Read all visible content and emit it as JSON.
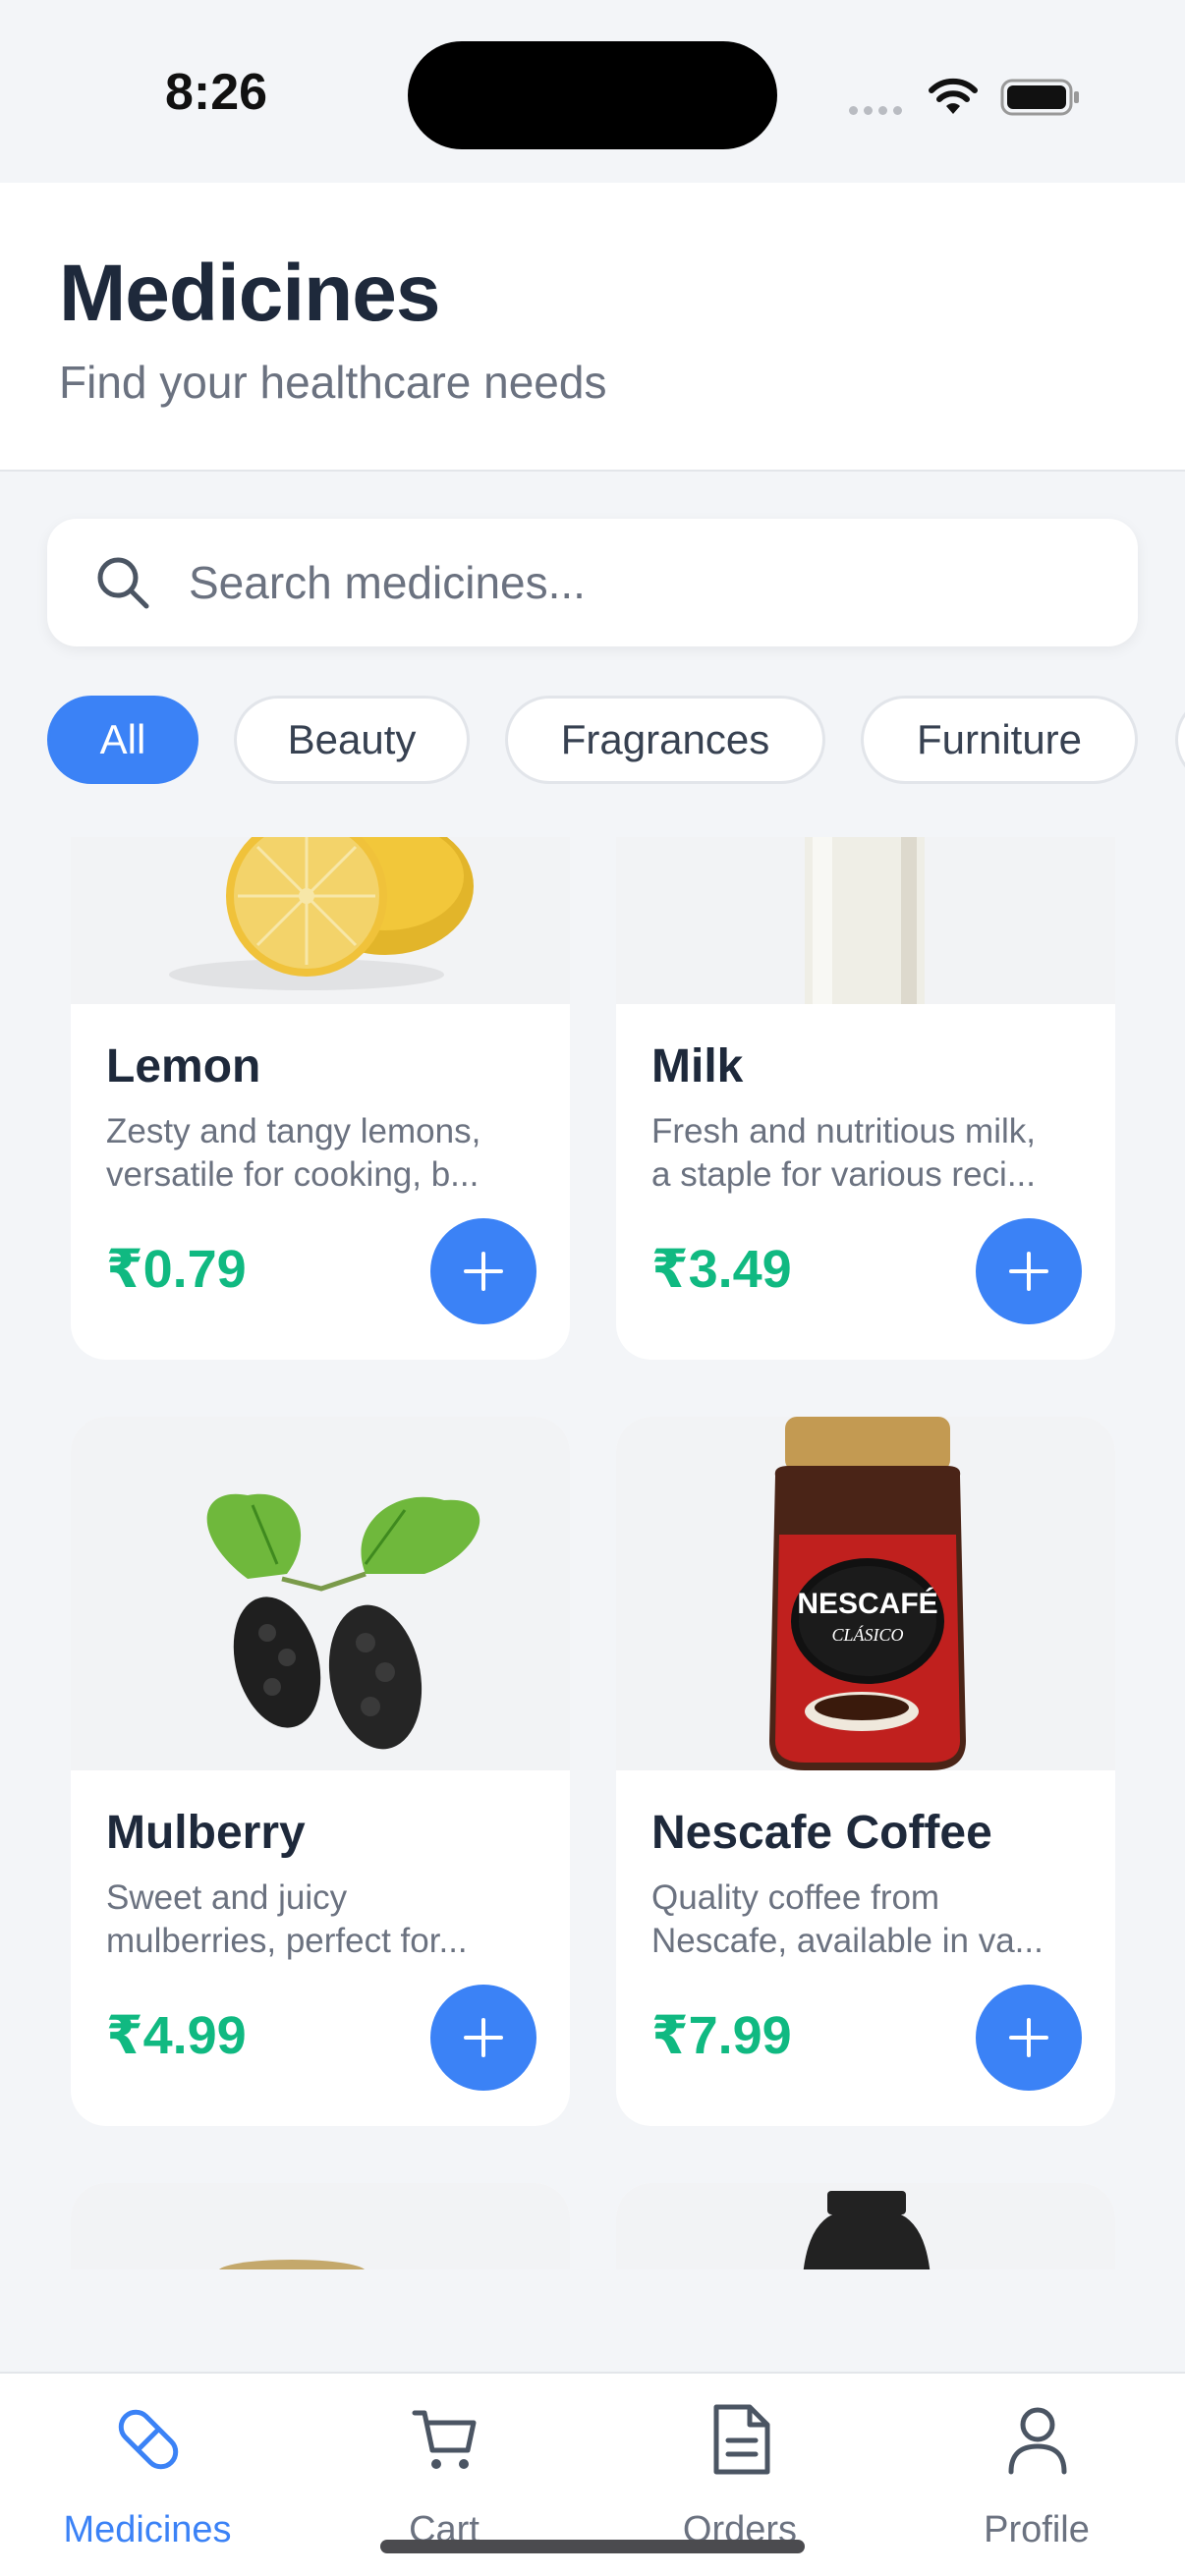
{
  "status_bar": {
    "time": "8:26"
  },
  "header": {
    "title": "Medicines",
    "subtitle": "Find your healthcare needs"
  },
  "search": {
    "placeholder": "Search medicines...",
    "value": ""
  },
  "categories": [
    {
      "label": "All",
      "active": true
    },
    {
      "label": "Beauty",
      "active": false
    },
    {
      "label": "Fragrances",
      "active": false
    },
    {
      "label": "Furniture",
      "active": false
    }
  ],
  "products": [
    {
      "name": "Lemon",
      "desc_line1": "Zesty and tangy lemons,",
      "desc_line2": "versatile for cooking, b...",
      "price": "₹0.79",
      "image_icon": "lemon-image"
    },
    {
      "name": "Milk",
      "desc_line1": "Fresh and nutritious milk,",
      "desc_line2": "a staple for various reci...",
      "price": "₹3.49",
      "image_icon": "milk-bottle-image"
    },
    {
      "name": "Mulberry",
      "desc_line1": "Sweet and juicy",
      "desc_line2": "mulberries, perfect for...",
      "price": "₹4.99",
      "image_icon": "mulberry-image"
    },
    {
      "name": "Nescafe Coffee",
      "desc_line1": "Quality coffee from",
      "desc_line2": "Nescafe, available in va...",
      "price": "₹7.99",
      "image_icon": "coffee-jar-image"
    }
  ],
  "coffee_label": {
    "brand": "NESCAFÉ",
    "variant": "CLÁSICO"
  },
  "tabs": [
    {
      "label": "Medicines",
      "icon": "pill-icon",
      "active": true
    },
    {
      "label": "Cart",
      "icon": "cart-icon",
      "active": false
    },
    {
      "label": "Orders",
      "icon": "document-icon",
      "active": false
    },
    {
      "label": "Profile",
      "icon": "person-icon",
      "active": false
    }
  ],
  "colors": {
    "accent": "#3b82f6",
    "price": "#10b981",
    "title": "#1e293b",
    "muted": "#6b7280",
    "background": "#f3f5f8"
  }
}
